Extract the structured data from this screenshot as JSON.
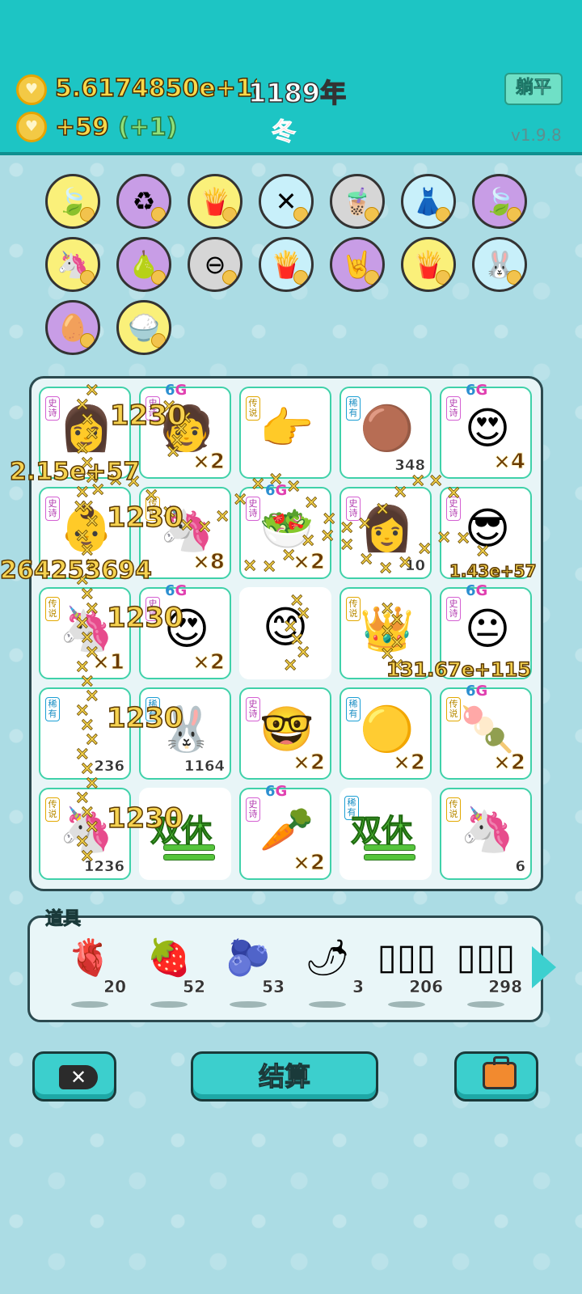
{
  "header": {
    "money": "5.6174850e+189",
    "year": "1189年",
    "income": "+59",
    "bonus": "(+1)",
    "season": "冬",
    "flat_button": "躺平",
    "version": "v1.9.8"
  },
  "collection_icons": [
    {
      "name": "leaf-icon",
      "glyph": "🍃",
      "bg": "y"
    },
    {
      "name": "recycle-icon",
      "glyph": "♻",
      "bg": "p"
    },
    {
      "name": "fries-icon",
      "glyph": "🍟",
      "bg": "y"
    },
    {
      "name": "sticks-icon",
      "glyph": "✕",
      "bg": "b"
    },
    {
      "name": "milk-tea-icon",
      "glyph": "🧋",
      "bg": "g"
    },
    {
      "name": "skirt-icon",
      "glyph": "👗",
      "bg": "b"
    },
    {
      "name": "leaf-icon",
      "glyph": "🍃",
      "bg": "p"
    },
    {
      "name": "unicorn-icon",
      "glyph": "🦄",
      "bg": "y"
    },
    {
      "name": "grapefruit-icon",
      "glyph": "🍐",
      "bg": "p"
    },
    {
      "name": "minus-icon",
      "glyph": "⊖",
      "bg": "g"
    },
    {
      "name": "fries-icon",
      "glyph": "🍟",
      "bg": "b"
    },
    {
      "name": "rock-hand-icon",
      "glyph": "🤘",
      "bg": "p"
    },
    {
      "name": "fries-icon",
      "glyph": "🍟",
      "bg": "y"
    },
    {
      "name": "rabbit-icon",
      "glyph": "🐰",
      "bg": "b"
    },
    {
      "name": "egg-bag-icon",
      "glyph": "🥚",
      "bg": "p"
    },
    {
      "name": "rice-bowl-icon",
      "glyph": "🍚",
      "bg": "y"
    }
  ],
  "board": {
    "tiles": [
      {
        "tag": "史诗",
        "type": "epic",
        "glyph": "👩",
        "count": ""
      },
      {
        "tag": "史诗",
        "type": "epic",
        "glyph": "🧑",
        "count": "×2",
        "six": true
      },
      {
        "tag": "传说",
        "type": "legend",
        "glyph": "👉",
        "count": ""
      },
      {
        "tag": "稀有",
        "type": "rare",
        "glyph": "🟤",
        "count": "348"
      },
      {
        "tag": "史诗",
        "type": "epic",
        "glyph": "😍",
        "count": "×4",
        "six": true
      },
      {
        "tag": "史诗",
        "type": "epic",
        "glyph": "👶",
        "count": ""
      },
      {
        "tag": "传说",
        "type": "legend",
        "glyph": "🦄",
        "count": "×8"
      },
      {
        "tag": "史诗",
        "type": "epic",
        "glyph": "🥗",
        "count": "×2",
        "six": true
      },
      {
        "tag": "史诗",
        "type": "epic",
        "glyph": "👩",
        "count": "10"
      },
      {
        "tag": "史诗",
        "type": "epic",
        "glyph": "😎",
        "count": ""
      },
      {
        "tag": "传说",
        "type": "legend",
        "glyph": "🦄",
        "count": "×1"
      },
      {
        "tag": "史诗",
        "type": "epic",
        "glyph": "😍",
        "count": "×2",
        "six": true
      },
      {
        "tag": "",
        "type": "none",
        "glyph": "😊",
        "count": ""
      },
      {
        "tag": "传说",
        "type": "legend",
        "glyph": "👑",
        "count": ""
      },
      {
        "tag": "史诗",
        "type": "epic",
        "glyph": "😐",
        "count": "",
        "six": true
      },
      {
        "tag": "稀有",
        "type": "rare",
        "glyph": "",
        "count": "236"
      },
      {
        "tag": "稀有",
        "type": "rare",
        "glyph": "🐰",
        "count": "1164"
      },
      {
        "tag": "史诗",
        "type": "epic",
        "glyph": "🤓",
        "count": "×2"
      },
      {
        "tag": "稀有",
        "type": "rare",
        "glyph": "🟡",
        "count": "×2"
      },
      {
        "tag": "传说",
        "type": "legend",
        "glyph": "🍡",
        "count": "×2",
        "six": true
      },
      {
        "tag": "传说",
        "type": "legend",
        "glyph": "🦄",
        "count": "1236"
      },
      {
        "tag": "",
        "type": "double",
        "glyph": "",
        "count": "",
        "double": "双休"
      },
      {
        "tag": "史诗",
        "type": "epic",
        "glyph": "🥕",
        "count": "×2",
        "six": true
      },
      {
        "tag": "稀有",
        "type": "rare",
        "glyph": "",
        "count": "",
        "double": "双休"
      },
      {
        "tag": "传说",
        "type": "legend",
        "glyph": "🦄",
        "count": "6"
      }
    ],
    "floating": [
      {
        "text": "1230",
        "tag": "f1"
      },
      {
        "text": "2.15e+57",
        "tag": "f2"
      },
      {
        "text": "1230",
        "tag": "f3"
      },
      {
        "text": "264253694",
        "tag": "f4"
      },
      {
        "text": "1230",
        "tag": "f5"
      },
      {
        "text": "1230",
        "tag": "f6"
      },
      {
        "text": "1230",
        "tag": "f7"
      },
      {
        "text": "1.43e+57",
        "tag": "f8"
      },
      {
        "text": "131.67e+115",
        "tag": "f9"
      }
    ],
    "six_g_label": {
      "six": "6",
      "g": "G"
    }
  },
  "props": {
    "title": "道具",
    "items": [
      {
        "name": "liver-icon",
        "glyph": "🫀",
        "count": "20"
      },
      {
        "name": "strawberry-icon",
        "glyph": "🍓",
        "count": "52"
      },
      {
        "name": "blueberry-icon",
        "glyph": "🫐",
        "count": "53"
      },
      {
        "name": "chili-icon",
        "glyph": "🌶",
        "count": "3"
      },
      {
        "name": "white-cards-icon",
        "glyph": "▯▯▯",
        "count": "206"
      },
      {
        "name": "rare-cards-icon",
        "glyph": "▯▯▯",
        "count": "298"
      }
    ]
  },
  "buttons": {
    "settle": "结算"
  }
}
